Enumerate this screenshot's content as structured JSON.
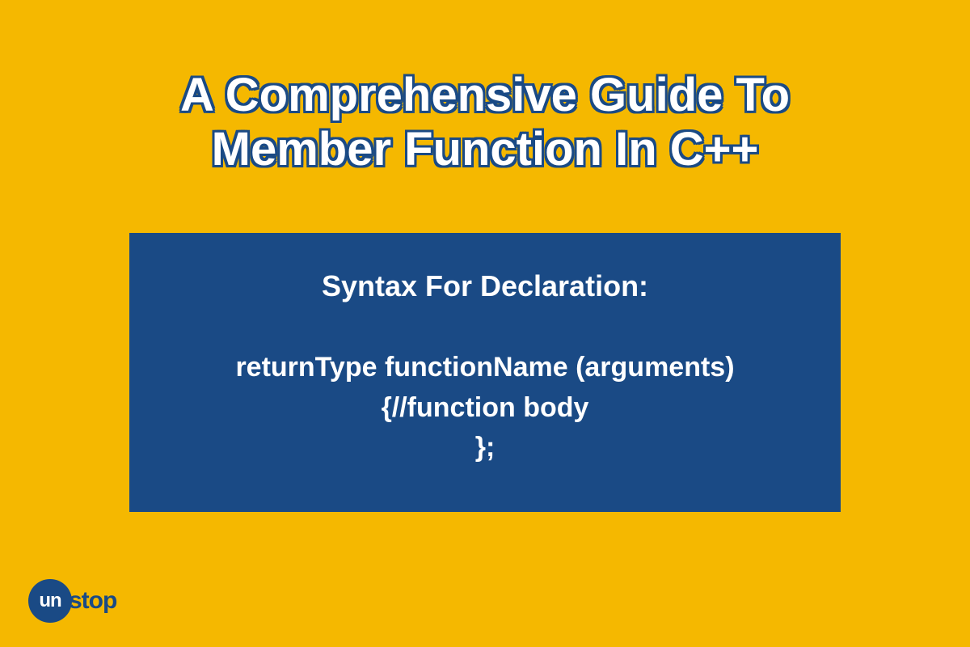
{
  "title": {
    "line1": "A Comprehensive Guide To",
    "line2": "Member Function In C++"
  },
  "syntax": {
    "heading": "Syntax For Declaration:",
    "line1": "returnType functionName (arguments)",
    "line2": "{//function body",
    "line3": "};"
  },
  "logo": {
    "part1": "un",
    "part2": "stop"
  }
}
